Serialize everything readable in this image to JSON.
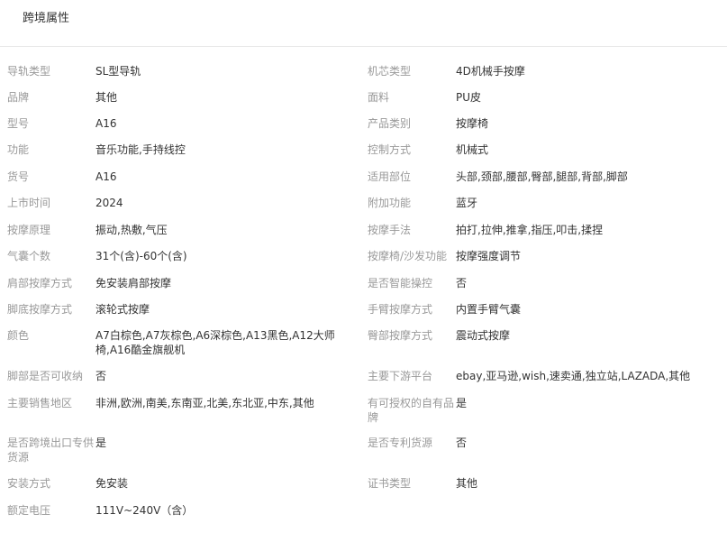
{
  "header": {
    "title": "跨境属性"
  },
  "rows": [
    {
      "left_label": "导轨类型",
      "left_value": "SL型导轨",
      "right_label": "机芯类型",
      "right_value": "4D机械手按摩"
    },
    {
      "left_label": "品牌",
      "left_value": "其他",
      "right_label": "面料",
      "right_value": "PU皮"
    },
    {
      "left_label": "型号",
      "left_value": "A16",
      "right_label": "产品类别",
      "right_value": "按摩椅"
    },
    {
      "left_label": "功能",
      "left_value": "音乐功能,手持线控",
      "right_label": "控制方式",
      "right_value": "机械式"
    },
    {
      "left_label": "货号",
      "left_value": "A16",
      "right_label": "适用部位",
      "right_value": "头部,颈部,腰部,臀部,腿部,背部,脚部"
    },
    {
      "left_label": "上市时间",
      "left_value": "2024",
      "right_label": "附加功能",
      "right_value": "蓝牙"
    },
    {
      "left_label": "按摩原理",
      "left_value": "振动,热敷,气压",
      "right_label": "按摩手法",
      "right_value": "拍打,拉伸,推拿,指压,叩击,揉捏"
    },
    {
      "left_label": "气囊个数",
      "left_value": "31个(含)-60个(含)",
      "right_label": "按摩椅/沙发功能",
      "right_value": "按摩强度调节"
    },
    {
      "left_label": "肩部按摩方式",
      "left_value": "免安装肩部按摩",
      "right_label": "是否智能操控",
      "right_value": "否"
    },
    {
      "left_label": "脚底按摩方式",
      "left_value": "滚轮式按摩",
      "right_label": "手臂按摩方式",
      "right_value": "内置手臂气囊"
    },
    {
      "left_label": "颜色",
      "left_value": "A7白棕色,A7灰棕色,A6深棕色,A13黑色,A12大师椅,A16酷金旗舰机",
      "right_label": "臀部按摩方式",
      "right_value": "震动式按摩"
    },
    {
      "left_label": "脚部是否可收纳",
      "left_value": "否",
      "right_label": "主要下游平台",
      "right_value": "ebay,亚马逊,wish,速卖通,独立站,LAZADA,其他"
    },
    {
      "left_label": "主要销售地区",
      "left_value": "非洲,欧洲,南美,东南亚,北美,东北亚,中东,其他",
      "right_label": "有可授权的自有品牌",
      "right_value": "是"
    },
    {
      "left_label": "是否跨境出口专供货源",
      "left_value": "是",
      "right_label": "是否专利货源",
      "right_value": "否"
    },
    {
      "left_label": "安装方式",
      "left_value": "免安装",
      "right_label": "证书类型",
      "right_value": "其他"
    },
    {
      "left_label": "额定电压",
      "left_value": "111V~240V（含）",
      "right_label": "",
      "right_value": ""
    }
  ]
}
